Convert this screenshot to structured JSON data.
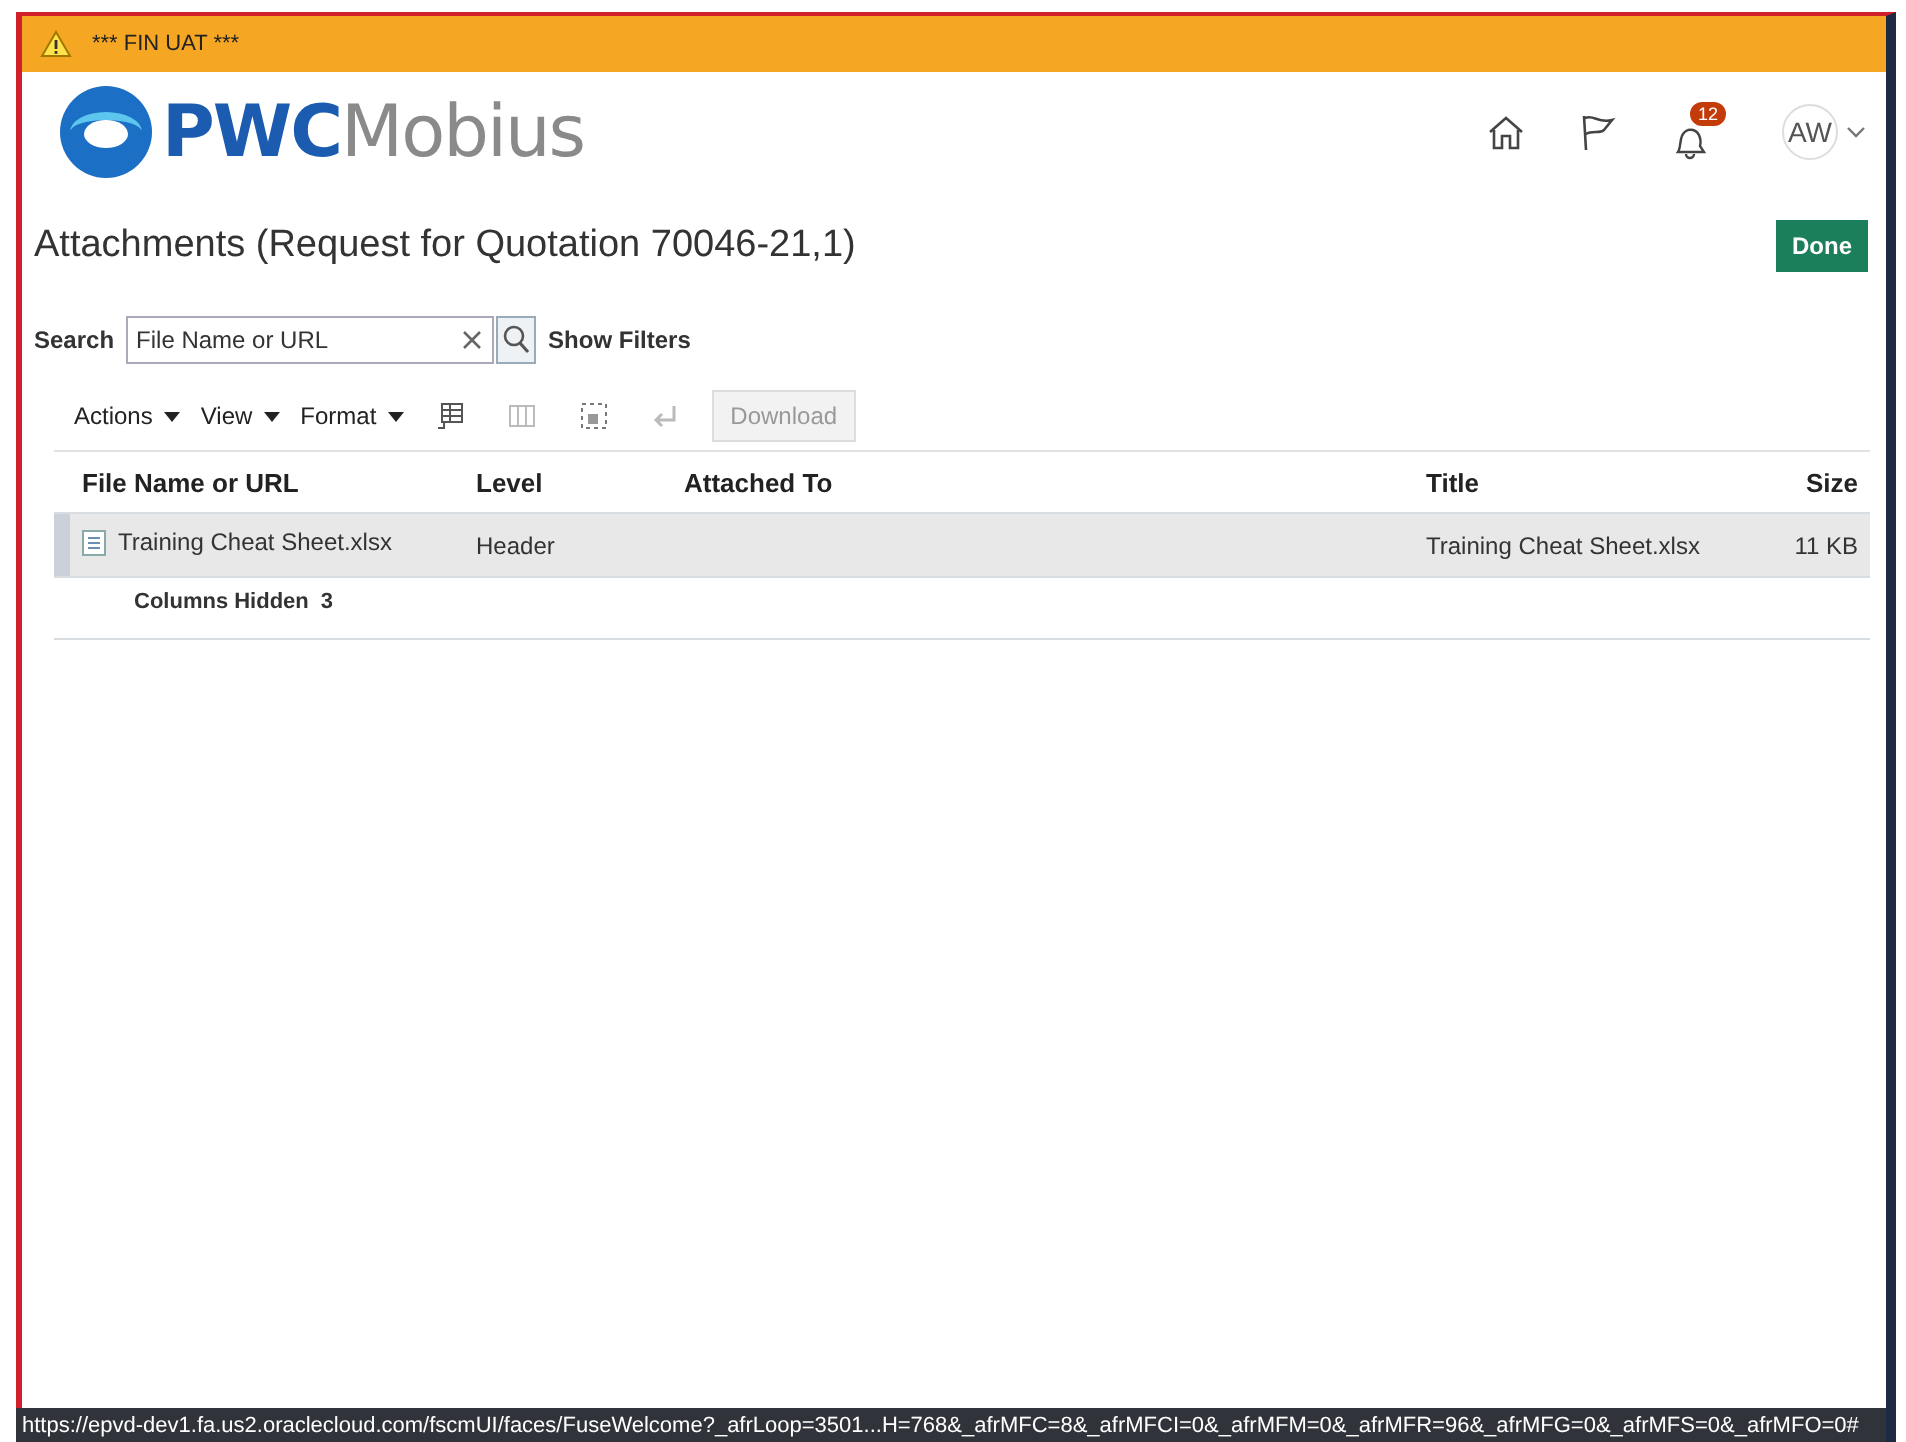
{
  "banner": {
    "text": "*** FIN UAT ***"
  },
  "logo": {
    "text": "**PWC**Mobius"
  },
  "header": {
    "notification_count": "12",
    "avatar": "AW"
  },
  "page": {
    "title": "Attachments (Request for Quotation 70046-21,1)",
    "done": "Done"
  },
  "search": {
    "label": "Search",
    "placeholder": "File Name or URL",
    "show_filters": "Show Filters"
  },
  "toolbar": {
    "menus": [
      "Actions",
      "View",
      "Format"
    ],
    "download": {
      "label": "Download",
      "disabled": true
    }
  },
  "table": {
    "columns": [
      {
        "label": "File Name or URL"
      },
      {
        "label": "Level"
      },
      {
        "label": "Attached To"
      },
      {
        "label": "Title"
      },
      {
        "label": "Size"
      }
    ],
    "rows": [
      {
        "selected": true,
        "cells": [
          "Training Cheat Sheet.xlsx",
          "Header",
          "",
          "Training Cheat Sheet.xlsx",
          "11 KB"
        ]
      }
    ],
    "columns_hidden": {
      "label": "Columns Hidden",
      "count": "3"
    }
  },
  "status_bar": {
    "url": "https://epvd-dev1.fa.us2.oraclecloud.com/fscmUI/faces/FuseWelcome?_afrLoop=3501...H=768&_afrMFC=8&_afrMFCI=0&_afrMFM=0&_afrMFR=96&_afrMFG=0&_afrMFS=0&_afrMFO=0#"
  }
}
